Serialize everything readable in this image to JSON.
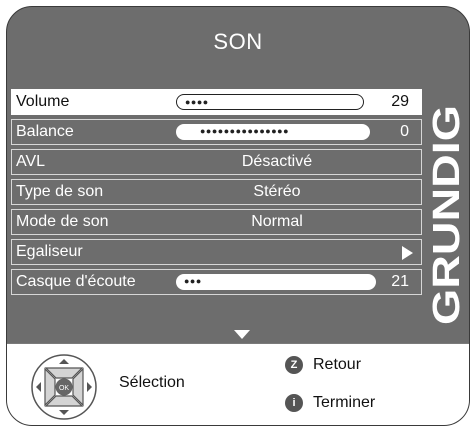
{
  "menu": {
    "title": "SON",
    "items": [
      {
        "label": "Volume",
        "type": "slider",
        "value": 29,
        "max": 100,
        "selected": true
      },
      {
        "label": "Balance",
        "type": "slider",
        "value": 0,
        "style": "balance"
      },
      {
        "label": "AVL",
        "type": "value",
        "value": "Désactivé"
      },
      {
        "label": "Type de son",
        "type": "value",
        "value": "Stéréo"
      },
      {
        "label": "Mode de son",
        "type": "value",
        "value": "Normal"
      },
      {
        "label": "Egaliseur",
        "type": "submenu"
      },
      {
        "label": "Casque d'écoute",
        "type": "slider",
        "value": 21,
        "max": 100
      }
    ]
  },
  "brand": {
    "logo_text": "GRUNDIG"
  },
  "footer": {
    "nav_center": "OK",
    "select_label": "Sélection",
    "back_key": "Z",
    "back_label": "Retour",
    "exit_key": "i",
    "exit_label": "Terminer"
  },
  "colors": {
    "panel": "#6d6d6d",
    "selected_row": "#ffffff",
    "footer": "#ffffff"
  }
}
